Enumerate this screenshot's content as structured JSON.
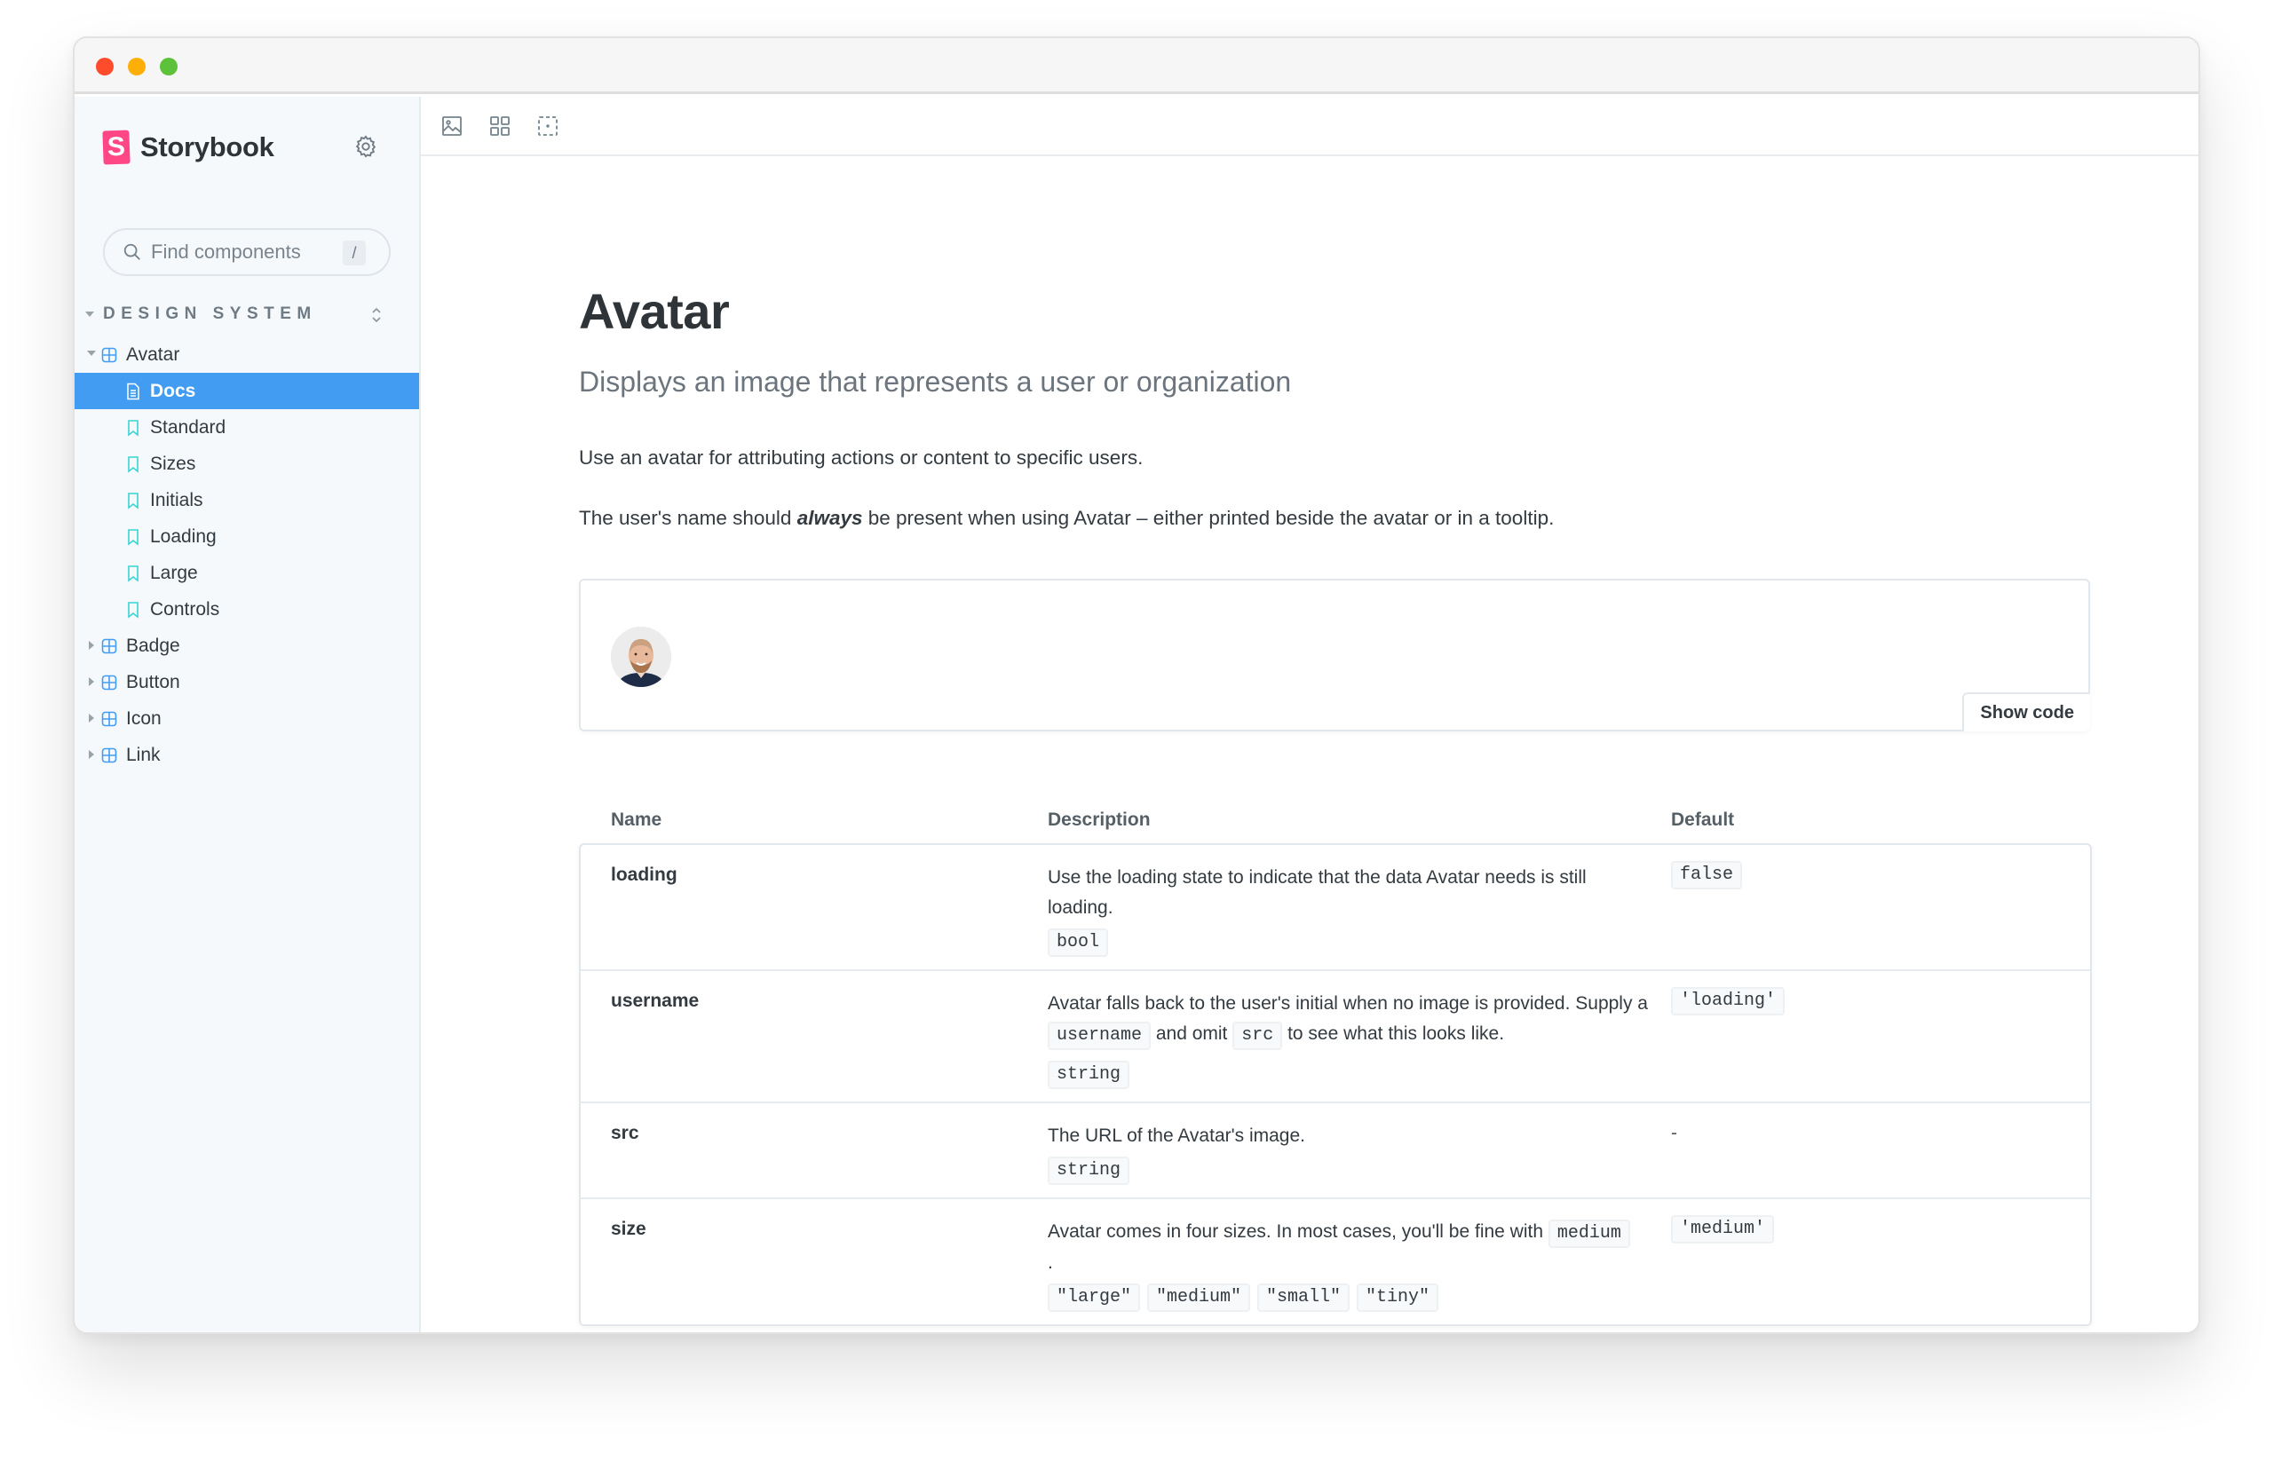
{
  "app": {
    "name": "Storybook"
  },
  "colors": {
    "brand": "#ff4785",
    "selected": "#429df2",
    "story_icon": "#37d5d3",
    "component_icon": "#429df2"
  },
  "search": {
    "placeholder": "Find components",
    "shortcut": "/"
  },
  "sidebar": {
    "group": "DESIGN SYSTEM",
    "items": [
      {
        "label": "Avatar",
        "type": "component",
        "expanded": true
      },
      {
        "label": "Docs",
        "type": "docs",
        "selected": true
      },
      {
        "label": "Standard",
        "type": "story"
      },
      {
        "label": "Sizes",
        "type": "story"
      },
      {
        "label": "Initials",
        "type": "story"
      },
      {
        "label": "Loading",
        "type": "story"
      },
      {
        "label": "Large",
        "type": "story"
      },
      {
        "label": "Controls",
        "type": "story"
      },
      {
        "label": "Badge",
        "type": "component",
        "expanded": false
      },
      {
        "label": "Button",
        "type": "component",
        "expanded": false
      },
      {
        "label": "Icon",
        "type": "component",
        "expanded": false
      },
      {
        "label": "Link",
        "type": "component",
        "expanded": false
      }
    ]
  },
  "toolbar": {
    "buttons": [
      {
        "icon": "image-icon"
      },
      {
        "icon": "grid-icon"
      },
      {
        "icon": "outline-icon"
      }
    ]
  },
  "doc": {
    "title": "Avatar",
    "subtitle": "Displays an image that represents a user or organization",
    "p1": "Use an avatar for attributing actions or content to specific users.",
    "p2_before": "The user's name should ",
    "p2_bold": "always",
    "p2_after": " be present when using Avatar – either printed beside the avatar or in a tooltip.",
    "show_code": "Show code"
  },
  "args": {
    "headers": {
      "name": "Name",
      "description": "Description",
      "default": "Default"
    },
    "rows": [
      {
        "name": "loading",
        "desc": "Use the loading state to indicate that the data Avatar needs is still loading.",
        "type": "bool",
        "default": "false"
      },
      {
        "name": "username",
        "desc_1": "Avatar falls back to the user's initial when no image is provided. Supply a ",
        "code_1": "username",
        "desc_2": " and omit ",
        "code_2": "src",
        "desc_3": " to see what this looks like.",
        "type": "string",
        "default": "'loading'"
      },
      {
        "name": "src",
        "desc": "The URL of the Avatar's image.",
        "type": "string",
        "default": "-"
      },
      {
        "name": "size",
        "desc_1": "Avatar comes in four sizes. In most cases, you'll be fine with ",
        "code_1": "medium",
        "desc_2": ".",
        "options": [
          "\"large\"",
          "\"medium\"",
          "\"small\"",
          "\"tiny\""
        ],
        "default": "'medium'"
      }
    ]
  }
}
